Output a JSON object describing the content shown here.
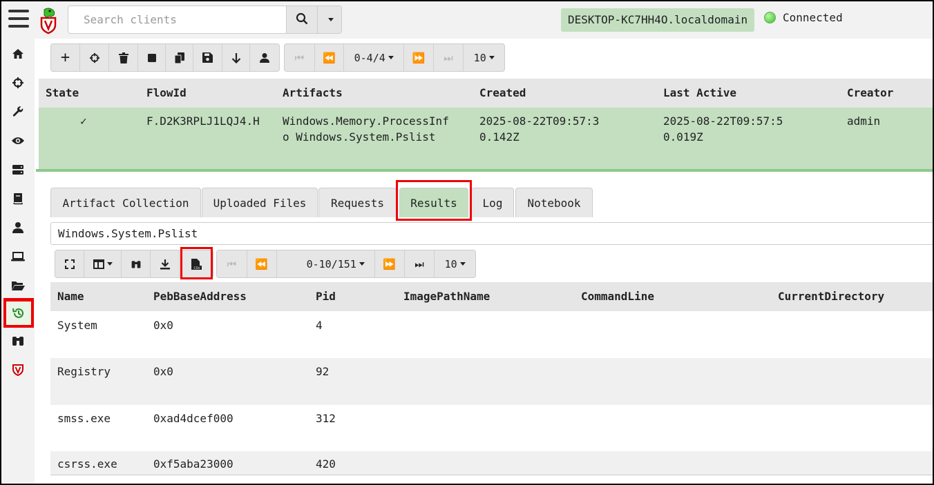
{
  "topbar": {
    "search_placeholder": "Search clients",
    "hostname": "DESKTOP-KC7HH4O.localdomain",
    "connection_status": "Connected"
  },
  "sidebar": {
    "items": [
      {
        "icon": "home-icon"
      },
      {
        "icon": "crosshair-icon"
      },
      {
        "icon": "wrench-icon"
      },
      {
        "icon": "eye-icon"
      },
      {
        "icon": "server-icon"
      },
      {
        "icon": "book-icon"
      },
      {
        "icon": "user-icon"
      },
      {
        "icon": "laptop-icon"
      },
      {
        "icon": "folder-icon"
      },
      {
        "icon": "history-icon",
        "active": true
      },
      {
        "icon": "binoculars-icon"
      },
      {
        "icon": "velociraptor-shield-icon"
      }
    ]
  },
  "flows_toolbar": {
    "page_range": "0-4/4",
    "page_size": "10"
  },
  "flows_table": {
    "columns": [
      "State",
      "FlowId",
      "Artifacts",
      "Created",
      "Last Active",
      "Creator"
    ],
    "rows": [
      {
        "state": "✓",
        "flow_id": "F.D2K3RPLJ1LQJ4.H",
        "artifacts": "Windows.Memory.ProcessInfo Windows.System.Pslist",
        "created": "2025-08-22T09:57:30.142Z",
        "last_active": "2025-08-22T09:57:50.019Z",
        "creator": "admin"
      }
    ]
  },
  "tabs": [
    "Artifact Collection",
    "Uploaded Files",
    "Requests",
    "Results",
    "Log",
    "Notebook"
  ],
  "active_tab": "Results",
  "results": {
    "artifact": "Windows.System.Pslist",
    "page_range": "0-10/151",
    "page_size": "10",
    "columns": [
      "Name",
      "PebBaseAddress",
      "Pid",
      "ImagePathName",
      "CommandLine",
      "CurrentDirectory"
    ],
    "rows": [
      {
        "name": "System",
        "peb": "0x0",
        "pid": "4"
      },
      {
        "name": "Registry",
        "peb": "0x0",
        "pid": "92"
      },
      {
        "name": "smss.exe",
        "peb": "0xad4dcef000",
        "pid": "312"
      },
      {
        "name": "csrss.exe",
        "peb": "0xf5aba23000",
        "pid": "420"
      }
    ]
  },
  "colors": {
    "accent_green": "#c3dfc0",
    "highlight_red": "#e00000"
  }
}
